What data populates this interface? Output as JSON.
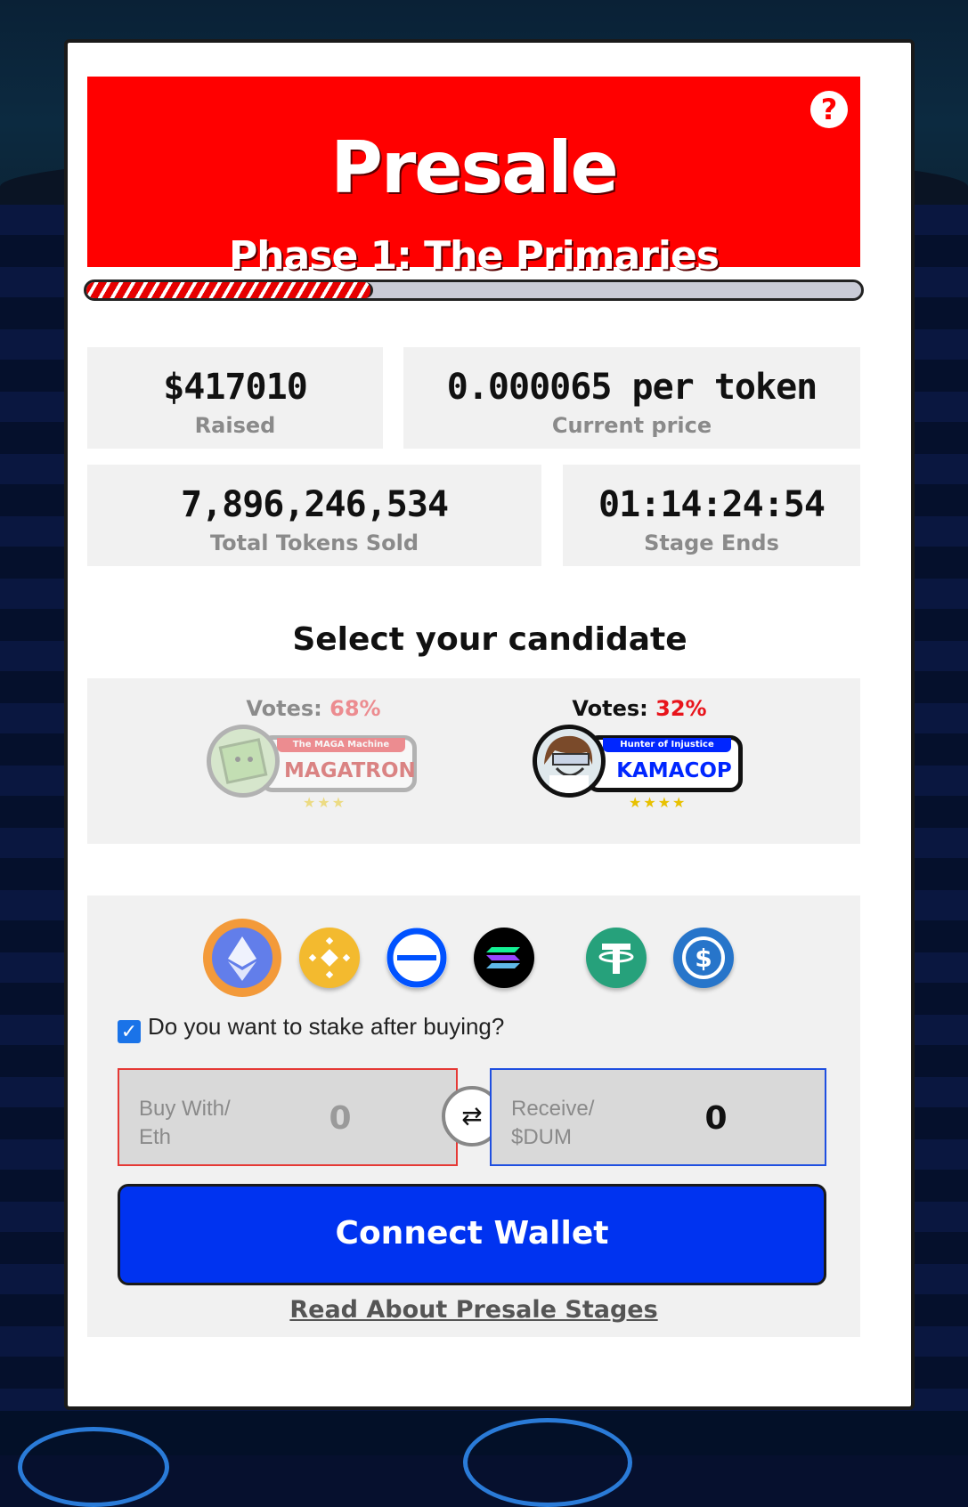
{
  "presale": {
    "title": "Presale",
    "phase": "Phase 1: The Primaries",
    "help_icon": "?",
    "progress_fraction": 0.37
  },
  "stats": {
    "raised_value": "$417010",
    "raised_label": "Raised",
    "price_value": "0.000065 per token",
    "price_label": "Current price",
    "tokens_value": "7,896,246,534",
    "tokens_label": "Total Tokens Sold",
    "timer_value": "01:14:24:54",
    "timer_label": "Stage Ends"
  },
  "candidates": {
    "title": "Select your candidate",
    "items": [
      {
        "votes_label": "Votes: ",
        "votes_pct": "68%",
        "tagline": "The MAGA Machine",
        "name": "MAGATRON",
        "stars": "★★★",
        "selected": false
      },
      {
        "votes_label": "Votes: ",
        "votes_pct": "32%",
        "tagline": "Hunter of Injustice",
        "name": "KAMACOP",
        "stars": "★★★★",
        "selected": true
      }
    ]
  },
  "purchase": {
    "currencies": [
      {
        "name": "eth-icon",
        "color": "#627eea",
        "selected": true
      },
      {
        "name": "bnb-icon",
        "color": "#f3ba2f",
        "selected": false
      },
      {
        "name": "base-icon",
        "color": "#0052ff",
        "selected": false
      },
      {
        "name": "solana-icon",
        "color": "#000000",
        "selected": false
      },
      {
        "name": "usdt-icon",
        "color": "#26a17b",
        "selected": false
      },
      {
        "name": "usdc-icon",
        "color": "#2775ca",
        "selected": false
      }
    ],
    "stake_label": "Do you want to stake after buying?",
    "stake_checked": true,
    "buy_label": "Buy With/\nEth",
    "buy_value": "0",
    "receive_label": "Receive/\n$DUM",
    "receive_value": "0",
    "connect_label": "Connect Wallet",
    "read_more_label": "Read About Presale Stages"
  },
  "colors": {
    "header_red": "#ff0000",
    "connect_blue": "#0033f0",
    "vote_red": "#e8141b"
  }
}
